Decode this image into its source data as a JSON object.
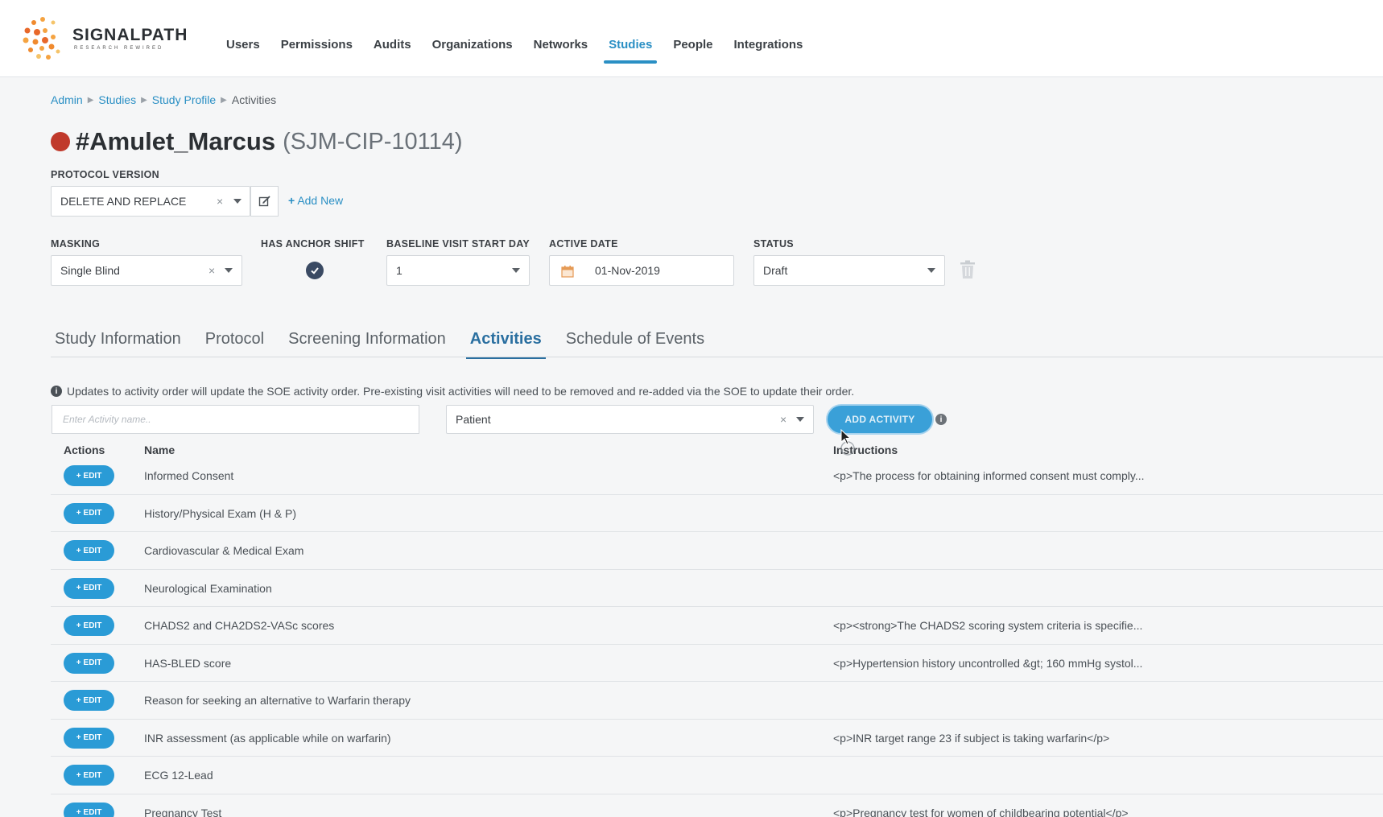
{
  "header": {
    "logo_text": "SIGNALPATH",
    "logo_tagline": "RESEARCH REWIRED",
    "nav": [
      "Users",
      "Permissions",
      "Audits",
      "Organizations",
      "Networks",
      "Studies",
      "People",
      "Integrations"
    ],
    "active_nav": "Studies"
  },
  "breadcrumb": {
    "items": [
      "Admin",
      "Studies",
      "Study Profile"
    ],
    "current": "Activities"
  },
  "study": {
    "name": "#Amulet_Marcus",
    "code": "(SJM-CIP-10114)",
    "status_color": "#c0392b"
  },
  "protocol": {
    "label": "PROTOCOL VERSION",
    "value": "DELETE AND REPLACE",
    "add_new": "Add New"
  },
  "masking": {
    "label": "MASKING",
    "value": "Single Blind"
  },
  "anchor_shift": {
    "label": "HAS ANCHOR SHIFT",
    "checked": true
  },
  "baseline": {
    "label": "BASELINE VISIT START DAY",
    "value": "1"
  },
  "active_date": {
    "label": "ACTIVE DATE",
    "value": "01-Nov-2019"
  },
  "status": {
    "label": "STATUS",
    "value": "Draft"
  },
  "tabs": [
    "Study Information",
    "Protocol",
    "Screening Information",
    "Activities",
    "Schedule of Events"
  ],
  "active_tab": "Activities",
  "notice": "Updates to activity order will update the SOE activity order. Pre-existing visit activities will need to be removed and re-added via the SOE to update their order.",
  "activity_form": {
    "placeholder": "Enter Activity name..",
    "type_value": "Patient",
    "add_button": "ADD ACTIVITY"
  },
  "table": {
    "headers": {
      "actions": "Actions",
      "name": "Name",
      "instructions": "Instructions"
    },
    "edit_label": "EDIT",
    "rows": [
      {
        "name": "Informed Consent",
        "instructions": "<p>The process for obtaining informed consent must comply..."
      },
      {
        "name": "History/Physical Exam (H & P)",
        "instructions": ""
      },
      {
        "name": "Cardiovascular & Medical Exam",
        "instructions": ""
      },
      {
        "name": "Neurological Examination",
        "instructions": ""
      },
      {
        "name": "CHADS2 and CHA2DS2-VASc scores",
        "instructions": "<p><strong>The CHADS2 scoring system criteria is specifie..."
      },
      {
        "name": "HAS-BLED score",
        "instructions": "<p>Hypertension history uncontrolled &gt; 160 mmHg systol..."
      },
      {
        "name": "Reason for seeking an alternative to Warfarin therapy",
        "instructions": ""
      },
      {
        "name": "INR assessment (as applicable while on warfarin)",
        "instructions": "<p>INR target range 23 if subject is taking warfarin</p>"
      },
      {
        "name": "ECG 12-Lead",
        "instructions": ""
      },
      {
        "name": "Pregnancy Test",
        "instructions": "<p>Pregnancy test for women of childbearing potential</p>"
      }
    ]
  },
  "colors": {
    "accent": "#2a8fc4",
    "edit_button": "#2a9bd6",
    "calendar_icon": "#e59a55"
  }
}
